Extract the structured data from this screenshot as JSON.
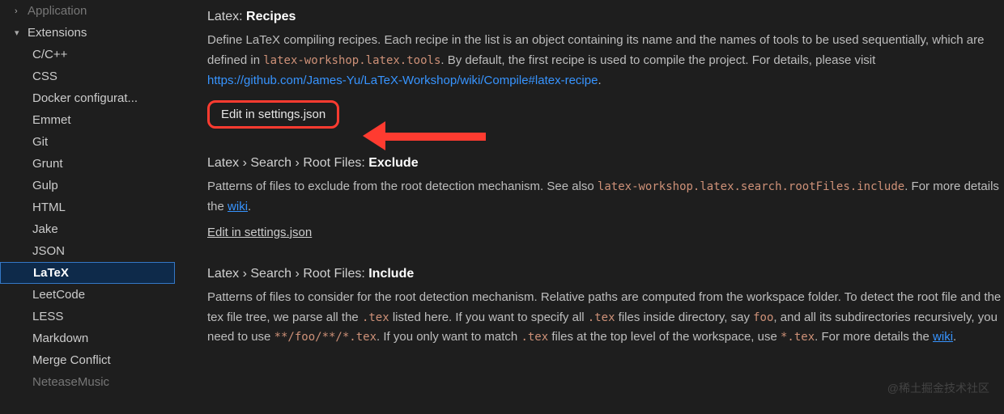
{
  "sidebar": {
    "items": [
      {
        "label": "Application",
        "level": 0,
        "chevron": "›",
        "dim": true
      },
      {
        "label": "Extensions",
        "level": 0,
        "chevron": "▾"
      },
      {
        "label": "C/C++",
        "level": 1
      },
      {
        "label": "CSS",
        "level": 1
      },
      {
        "label": "Docker configurat...",
        "level": 1
      },
      {
        "label": "Emmet",
        "level": 1
      },
      {
        "label": "Git",
        "level": 1
      },
      {
        "label": "Grunt",
        "level": 1
      },
      {
        "label": "Gulp",
        "level": 1
      },
      {
        "label": "HTML",
        "level": 1
      },
      {
        "label": "Jake",
        "level": 1
      },
      {
        "label": "JSON",
        "level": 1
      },
      {
        "label": "LaTeX",
        "level": 1,
        "selected": true
      },
      {
        "label": "LeetCode",
        "level": 1
      },
      {
        "label": "LESS",
        "level": 1
      },
      {
        "label": "Markdown",
        "level": 1
      },
      {
        "label": "Merge Conflict",
        "level": 1
      },
      {
        "label": "NeteaseMusic",
        "level": 1,
        "dim": true
      }
    ]
  },
  "settings": {
    "recipes": {
      "prefix": "Latex:",
      "name": "Recipes",
      "desc1": "Define LaTeX compiling recipes. Each recipe in the list is an object containing its name and the names of tools to be used sequentially, which are defined in ",
      "code1": "latex-workshop.latex.tools",
      "desc2": ". By default, the first recipe is used to compile the project. For details, please visit ",
      "link": "https://github.com/James-Yu/LaTeX-Workshop/wiki/Compile#latex-recipe",
      "desc3": ".",
      "edit": "Edit in settings.json"
    },
    "exclude": {
      "crumb1": "Latex",
      "crumb2": "Search",
      "crumb3": "Root Files:",
      "name": "Exclude",
      "desc1": "Patterns of files to exclude from the root detection mechanism. See also ",
      "code1": "latex-workshop.latex.search.rootFiles.include",
      "desc2": ". For more details the ",
      "wiki": "wiki",
      "desc3": ".",
      "edit": "Edit in settings.json"
    },
    "include": {
      "crumb1": "Latex",
      "crumb2": "Search",
      "crumb3": "Root Files:",
      "name": "Include",
      "d1": "Patterns of files to consider for the root detection mechanism. Relative paths are computed from the workspace folder. To detect the root file and the tex file tree, we parse all the ",
      "c1": ".tex",
      "d2": " listed here. If you want to specify all ",
      "c2": ".tex",
      "d3": " files inside directory, say ",
      "c3": "foo",
      "d4": ", and all its subdirectories recursively, you need to use ",
      "c4": "**/foo/**/*.tex",
      "d5": ". If you only want to match ",
      "c5": ".tex",
      "d6": " files at the top level of the workspace, use ",
      "c6": "*.tex",
      "d7": ". For more details the ",
      "wiki": "wiki",
      "d8": "."
    }
  },
  "watermark": "@稀土掘金技术社区",
  "sep": "›"
}
